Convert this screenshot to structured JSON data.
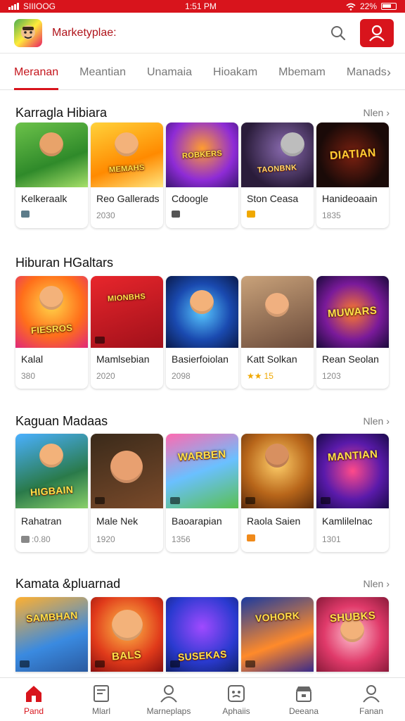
{
  "status_bar": {
    "carrier": "SIIIOOG",
    "time": "1:51 PM",
    "battery": "22%"
  },
  "header": {
    "search_value": "Marketyplae:",
    "logo_icon": "app-logo-icon",
    "search_icon": "search-icon",
    "profile_icon": "user-icon"
  },
  "tabs": {
    "items": [
      {
        "label": "Meranan"
      },
      {
        "label": "Meantian"
      },
      {
        "label": "Unamaia"
      },
      {
        "label": "Hioakam"
      },
      {
        "label": "Mbemam"
      },
      {
        "label": "Manads"
      }
    ],
    "more_icon": "chevron-right-icon"
  },
  "sections": [
    {
      "title": "Karragla Hibiara",
      "see_more": "Nlen",
      "cards": [
        {
          "name": "Kelkeraalk",
          "meta": "",
          "art": ""
        },
        {
          "name": "Reo Gallerads",
          "meta": "2030",
          "art": "MEMAHS"
        },
        {
          "name": "Cdoogle",
          "meta": "",
          "art": "ROBKERS"
        },
        {
          "name": "Ston Ceasa",
          "meta": "",
          "art": "TAONBNK"
        },
        {
          "name": "Hanideoaain",
          "meta": "1835",
          "art": "DIATIAN"
        }
      ]
    },
    {
      "title": "Hiburan HGaltars",
      "see_more": "",
      "cards": [
        {
          "name": "Kalal",
          "meta": "380",
          "art": "FIESROS"
        },
        {
          "name": "Mamlsebian",
          "meta": "2020",
          "art": "MIONBHS"
        },
        {
          "name": "Basierfoiolan",
          "meta": "2098",
          "art": ""
        },
        {
          "name": "Katt Solkan",
          "meta": "15",
          "art": ""
        },
        {
          "name": "Rean Seolan",
          "meta": "1203",
          "art": "MUWARS"
        }
      ]
    },
    {
      "title": "Kaguan Madaas",
      "see_more": "Nlen",
      "cards": [
        {
          "name": "Rahatran",
          "meta": ":0.80",
          "art": "HIGBAIN"
        },
        {
          "name": "Male Nek",
          "meta": "1920",
          "art": ""
        },
        {
          "name": "Baoarapian",
          "meta": "1356",
          "art": "WARBEN"
        },
        {
          "name": "Raola Saien",
          "meta": "",
          "art": ""
        },
        {
          "name": "Kamlilelnac",
          "meta": "1301",
          "art": "MANTIAN"
        }
      ]
    },
    {
      "title": "Kamata &pluarnad",
      "see_more": "Nlen",
      "cards": [
        {
          "name": "",
          "meta": "",
          "art": "SAMBHAN"
        },
        {
          "name": "",
          "meta": "",
          "art": "BALS"
        },
        {
          "name": "",
          "meta": "",
          "art": "SUSEKAS"
        },
        {
          "name": "",
          "meta": "",
          "art": "VOHORK"
        },
        {
          "name": "",
          "meta": "",
          "art": "SHUBKS"
        }
      ]
    }
  ],
  "bottom_nav": {
    "items": [
      {
        "label": "Pand",
        "icon": "home-icon"
      },
      {
        "label": "Mlarl",
        "icon": "document-icon"
      },
      {
        "label": "Marneplaps",
        "icon": "profile-icon"
      },
      {
        "label": "Aphaiis",
        "icon": "app-icon"
      },
      {
        "label": "Deeana",
        "icon": "store-icon"
      },
      {
        "label": "Fanan",
        "icon": "user-icon"
      }
    ]
  },
  "colors": {
    "accent": "#d8141c",
    "text": "#222222",
    "muted": "#777777",
    "star": "#f0a800"
  }
}
